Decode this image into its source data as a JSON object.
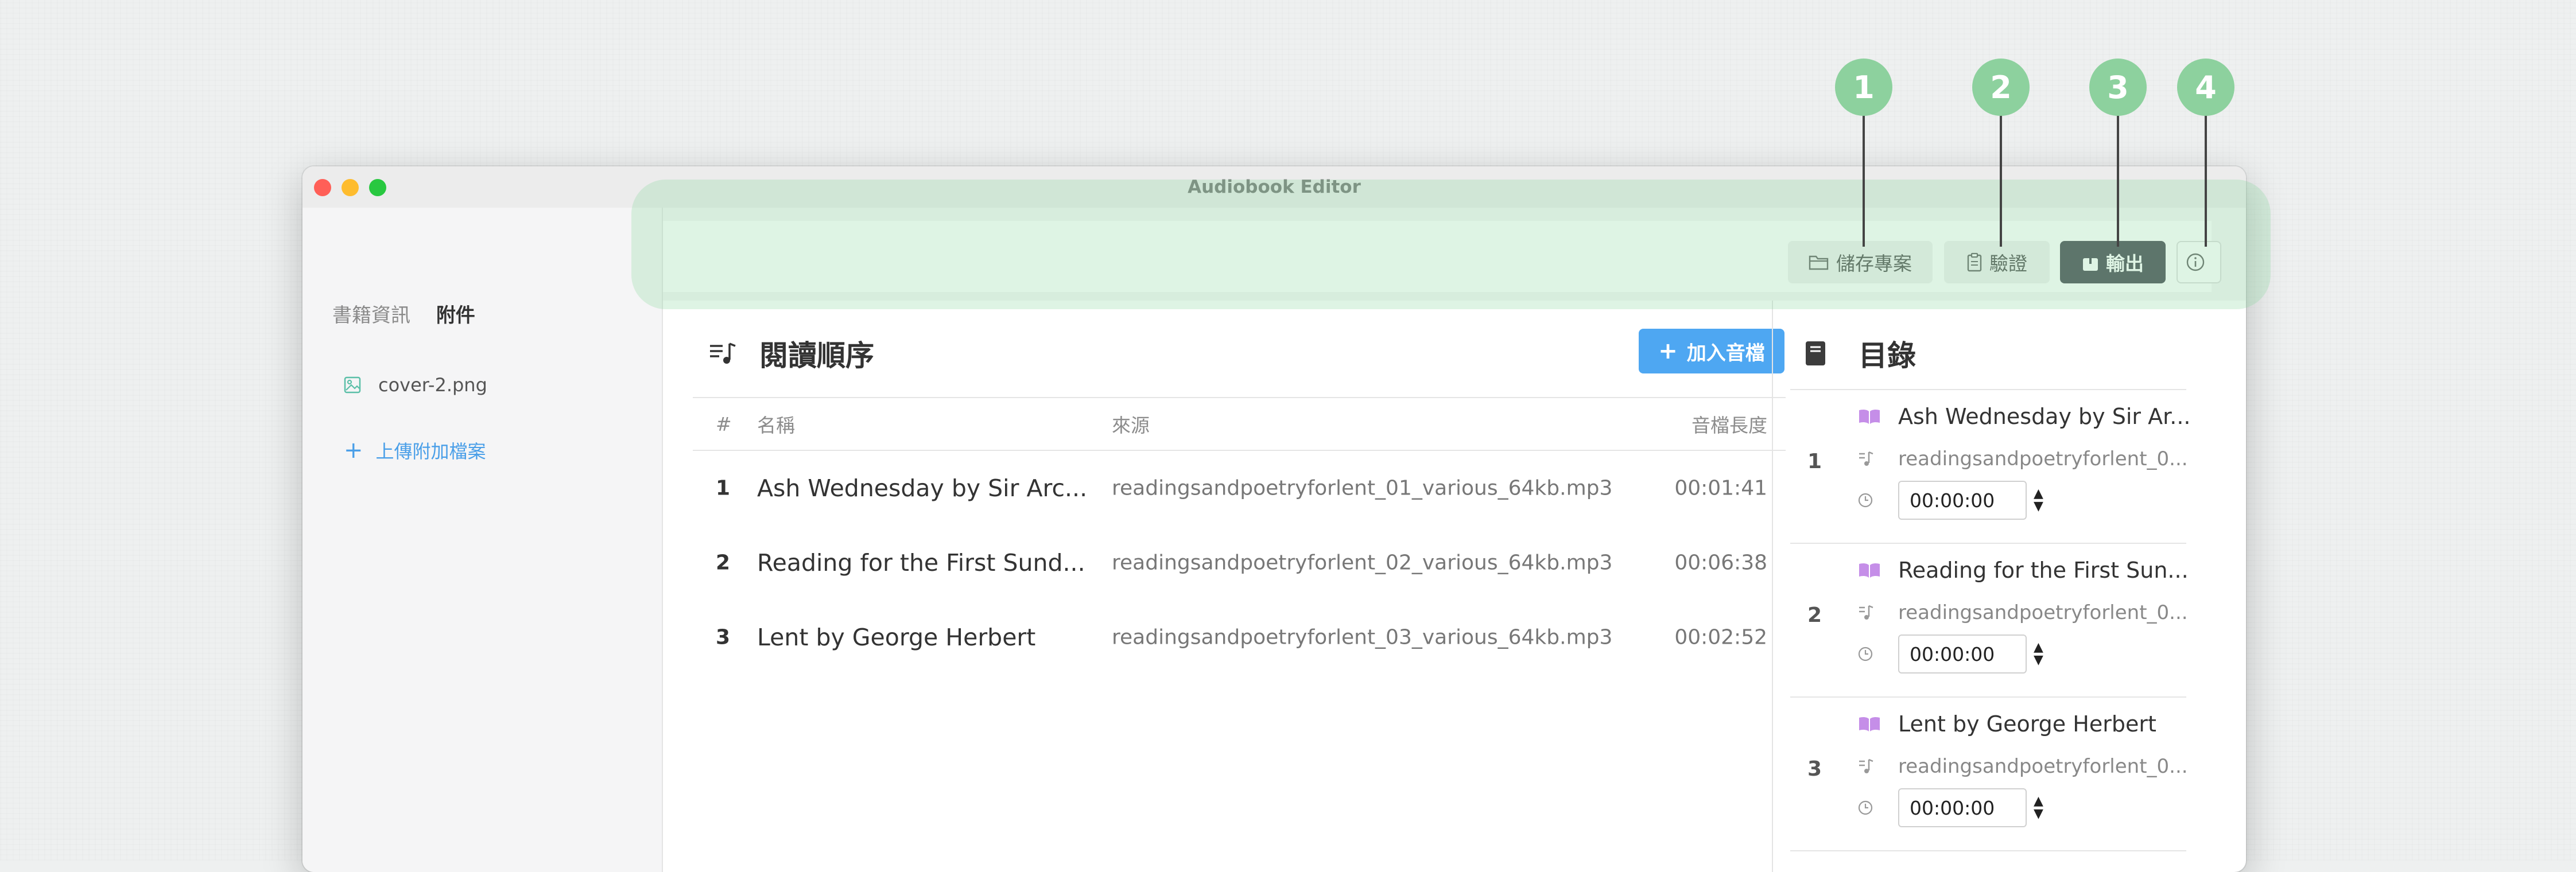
{
  "window": {
    "title": "Audiobook Editor"
  },
  "sidebar": {
    "tabs": [
      {
        "label": "書籍資訊"
      },
      {
        "label": "附件"
      }
    ],
    "files": [
      {
        "name": "cover-2.png",
        "icon": "image-icon"
      }
    ],
    "upload_label": "上傳附加檔案"
  },
  "toolbar": {
    "save_label": "儲存專案",
    "verify_label": "驗證",
    "export_label": "輸出",
    "info_icon": "info-icon"
  },
  "reading_order": {
    "title": "閱讀順序",
    "add_label": "加入音檔",
    "columns": {
      "num": "#",
      "name": "名稱",
      "source": "來源",
      "length": "音檔長度"
    },
    "rows": [
      {
        "num": "1",
        "name": "Ash Wednesday by Sir Arc...",
        "source": "readingsandpoetryforlent_01_various_64kb.mp3",
        "length": "00:01:41"
      },
      {
        "num": "2",
        "name": "Reading for the First Sund...",
        "source": "readingsandpoetryforlent_02_various_64kb.mp3",
        "length": "00:06:38"
      },
      {
        "num": "3",
        "name": "Lent by George Herbert",
        "source": "readingsandpoetryforlent_03_various_64kb.mp3",
        "length": "00:02:52"
      }
    ]
  },
  "toc": {
    "title": "目錄",
    "items": [
      {
        "num": "1",
        "name": "Ash Wednesday by Sir Ar...",
        "source": "readingsandpoetryforlent_0...",
        "time": "00:00:00"
      },
      {
        "num": "2",
        "name": "Reading for the First Sun...",
        "source": "readingsandpoetryforlent_0...",
        "time": "00:00:00"
      },
      {
        "num": "3",
        "name": "Lent by George Herbert",
        "source": "readingsandpoetryforlent_0...",
        "time": "00:00:00"
      }
    ]
  },
  "callouts": [
    "1",
    "2",
    "3",
    "4"
  ],
  "colors": {
    "accent_blue": "#4ea7f2",
    "export_dark": "#4d4f58",
    "callout_green": "#8dd19e",
    "book_purple": "#c58ee8"
  }
}
